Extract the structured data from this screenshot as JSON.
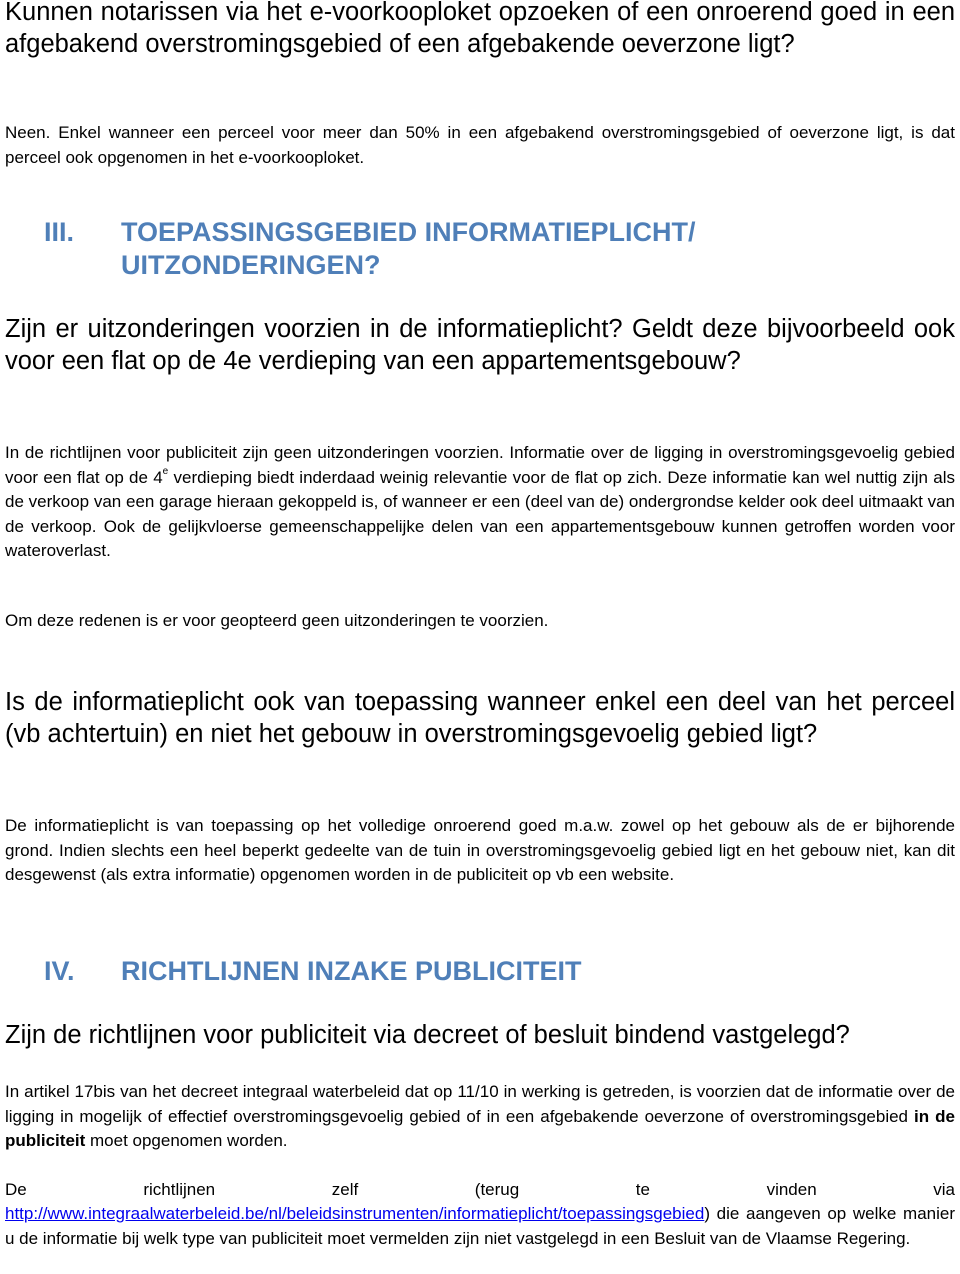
{
  "document": {
    "q1": {
      "question": "Kunnen notarissen via het e-voorkooploket opzoeken of een onroerend goed in een afgebakend overstromingsgebied of een afgebakende oeverzone ligt?",
      "answer": "Neen. Enkel wanneer een perceel voor meer dan 50% in een afgebakend overstromingsgebied of oeverzone ligt, is dat perceel ook opgenomen in het e-voorkooploket."
    },
    "section3": {
      "number": "III.",
      "title_line1": "TOEPASSINGSGEBIED INFORMATIEPLICHT/",
      "title_line2": "UITZONDERINGEN?"
    },
    "q2": {
      "question": "Zijn er uitzonderingen voorzien in de informatieplicht? Geldt deze bijvoorbeeld ook voor een flat op de 4e verdieping van een appartementsgebouw?",
      "answer_part1": "In de richtlijnen voor publiciteit zijn geen uitzonderingen voorzien. Informatie over de ligging in overstromingsgevoelig gebied voor een flat op de 4",
      "answer_sup": "e",
      "answer_part2": " verdieping biedt inderdaad weinig relevantie voor de flat op zich. Deze informatie kan wel nuttig zijn als de verkoop van een garage hieraan gekoppeld is, of wanneer er een (deel van de) ondergrondse kelder ook deel uitmaakt van de verkoop. Ook de gelijkvloerse gemeenschappelijke delen van een appartementsgebouw kunnen getroffen worden voor wateroverlast.",
      "conclusion": "Om deze redenen is er voor geopteerd geen uitzonderingen te voorzien."
    },
    "q3": {
      "question": "Is de informatieplicht ook van toepassing wanneer enkel een deel van het perceel (vb achtertuin) en niet het gebouw in overstromingsgevoelig gebied ligt?",
      "answer": "De informatieplicht is van toepassing op het volledige onroerend goed m.a.w. zowel op het gebouw als de er bijhorende grond. Indien slechts een heel beperkt gedeelte van de tuin in overstromingsgevoelig gebied ligt en het gebouw niet, kan dit desgewenst (als extra informatie) opgenomen worden in de publiciteit op vb een website."
    },
    "section4": {
      "number": "IV.",
      "title": "RICHTLIJNEN INZAKE PUBLICITEIT"
    },
    "q4": {
      "question": "Zijn de richtlijnen voor publiciteit via decreet of besluit bindend vastgelegd?",
      "answer_part1": "In artikel 17bis van het decreet integraal waterbeleid dat op 11/10 in werking is getreden, is voorzien dat de informatie over de ligging in mogelijk of effectief overstromingsgevoelig gebied of in een afgebakende oeverzone of overstromingsgebied ",
      "answer_bold": "in de publiciteit",
      "answer_part2": " moet opgenomen worden.",
      "para2_part1": "De richtlijnen zelf (terug te vinden via",
      "link_text": "http://www.integraalwaterbeleid.be/nl/beleidsinstrumenten/informatieplicht/toepassingsgebied",
      "para2_part2": ") die aangeven op welke manier u de informatie bij welk type van publiciteit moet vermelden zijn niet vastgelegd in een Besluit van de Vlaamse Regering."
    }
  },
  "colors": {
    "heading": "#4f7fb8",
    "text": "#000000",
    "link": "#0000ee"
  }
}
